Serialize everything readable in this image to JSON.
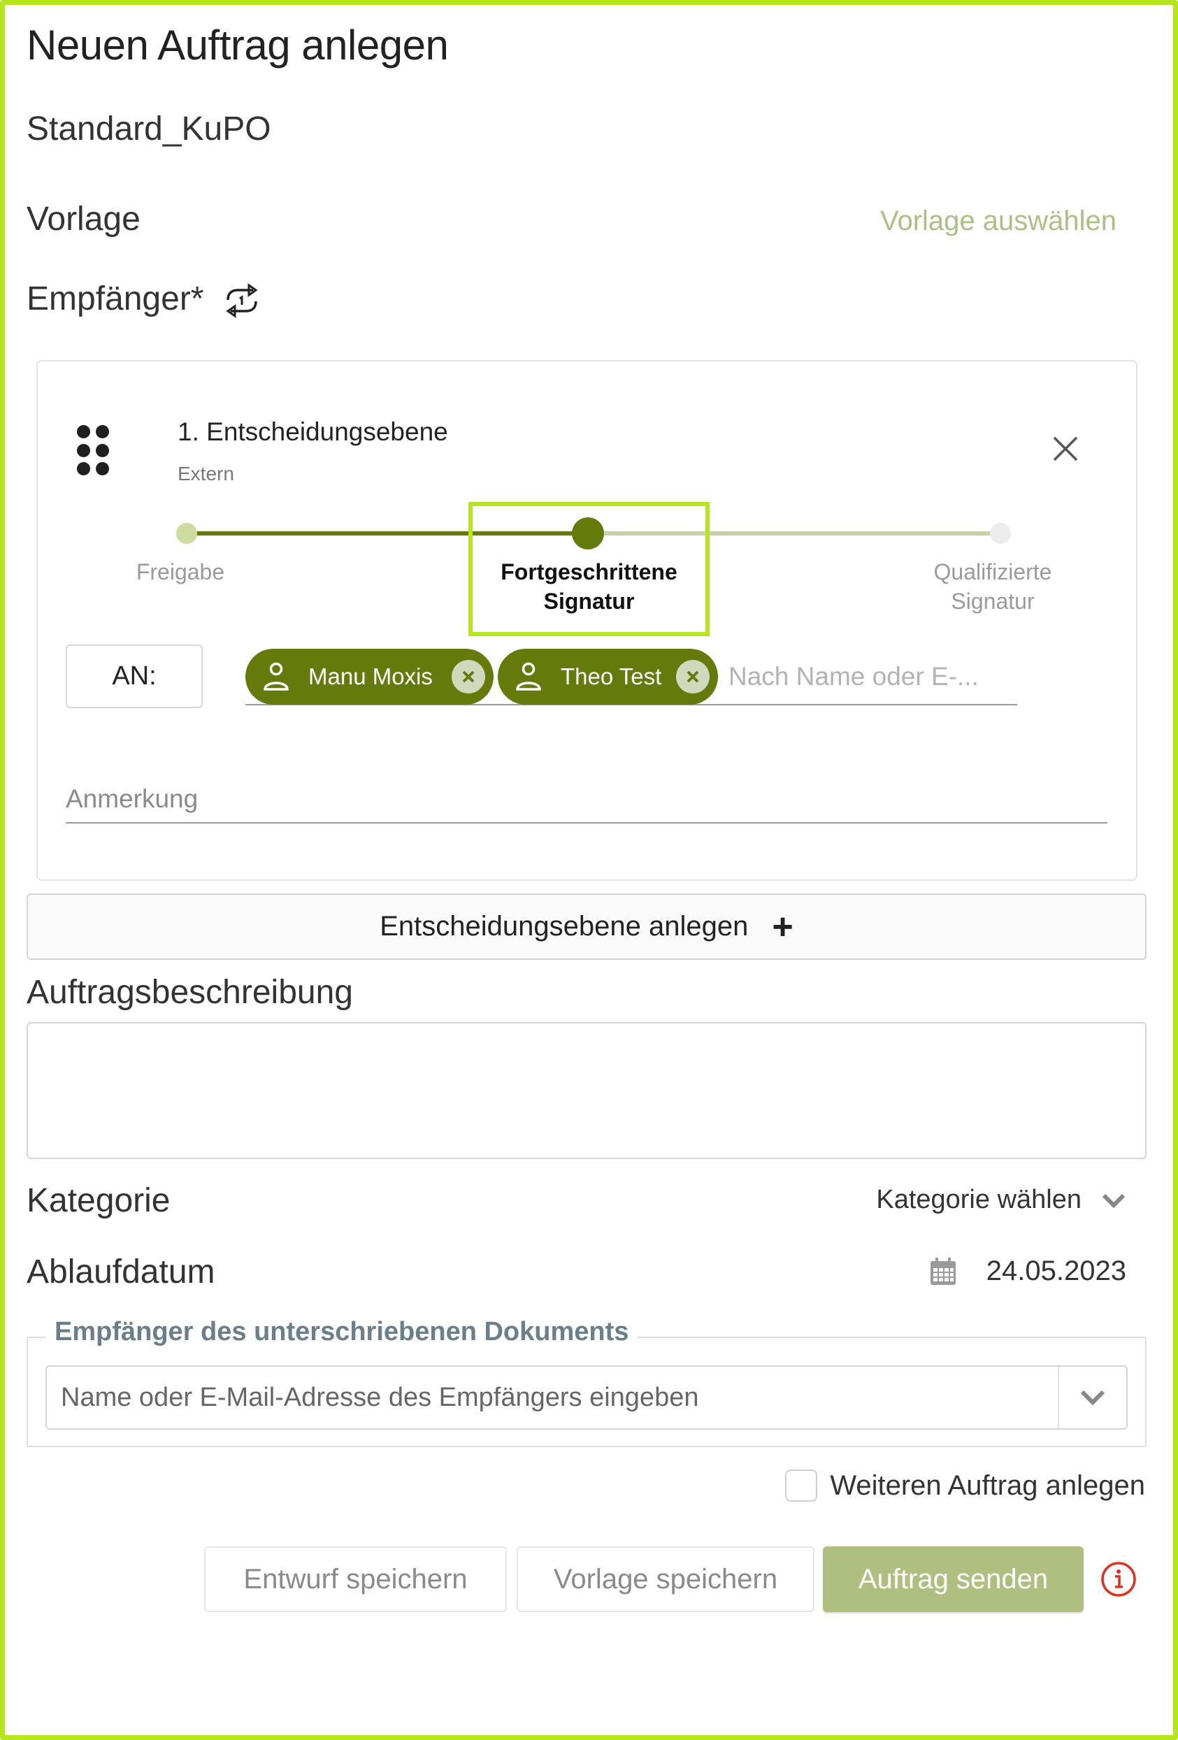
{
  "header": {
    "title": "Neuen Auftrag anlegen",
    "subtitle": "Standard_KuPO"
  },
  "template": {
    "label": "Vorlage",
    "select_link": "Vorlage auswählen"
  },
  "recipients": {
    "label": "Empfänger*",
    "toggle_icon": "repeat-one-icon"
  },
  "decision_level": {
    "title": "1. Entscheidungsebene",
    "subtitle": "Extern",
    "stepper": {
      "steps": [
        {
          "label_line1": "Freigabe",
          "label_line2": "",
          "state": "done"
        },
        {
          "label_line1": "Fortgeschrittene",
          "label_line2": "Signatur",
          "state": "active"
        },
        {
          "label_line1": "Qualifizierte",
          "label_line2": "Signatur",
          "state": "inactive"
        }
      ],
      "selected_index": 1
    },
    "to_label": "AN:",
    "chips": [
      {
        "name": "Manu Moxis"
      },
      {
        "name": "Theo Test"
      }
    ],
    "recipient_placeholder": "Nach Name oder E-...",
    "note_placeholder": "Anmerkung"
  },
  "add_level_button": "Entscheidungsebene anlegen",
  "description": {
    "label": "Auftragsbeschreibung",
    "value": ""
  },
  "category": {
    "label": "Kategorie",
    "selected": "Kategorie wählen"
  },
  "expiry": {
    "label": "Ablaufdatum",
    "value": "24.05.2023"
  },
  "signed_doc_recipient": {
    "legend": "Empfänger des unterschriebenen Dokuments",
    "placeholder": "Name oder E-Mail-Adresse des Empfängers eingeben"
  },
  "another_order": {
    "label": "Weiteren Auftrag anlegen",
    "checked": false
  },
  "actions": {
    "save_draft": "Entwurf speichern",
    "save_template": "Vorlage speichern",
    "send": "Auftrag senden"
  },
  "colors": {
    "frame": "#b5e61d",
    "primary": "#647b0c",
    "primary_light": "#afbf80",
    "link": "#aebf86",
    "info": "#e0301e"
  }
}
